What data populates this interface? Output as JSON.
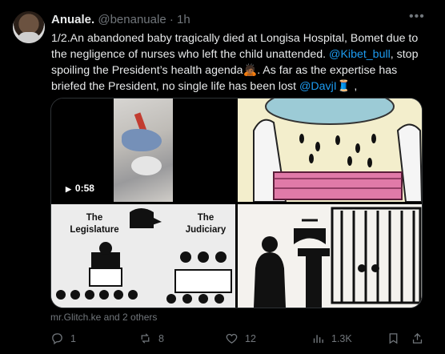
{
  "post": {
    "display_name": "Anuale.",
    "handle": "@benanuale",
    "dot": "·",
    "time": "1h",
    "more_icon": "more-icon",
    "text_part1": "1/2.An abandoned baby tragically died at Longisa Hospital, Bomet due to the negligence of nurses who left the child unattended. ",
    "mention1": "@Kibet_bull",
    "text_part2": ", stop spoiling the President’s health agenda🙇🏾. As far as the expertise has briefed the President, no single life has been lost ",
    "mention2": "@DavjI🧵",
    "text_part3": " ,"
  },
  "media": {
    "video_duration": "0:58",
    "image3_label_left": "The\nLegislature",
    "image3_label_right": "The\nJudiciary"
  },
  "footer_note": "mr.Glitch.ke and 2 others",
  "actions": {
    "reply_count": "1",
    "repost_count": "8",
    "like_count": "12",
    "views_count": "1.3K"
  },
  "colors": {
    "accent": "#1d9bf0",
    "muted": "#71767b",
    "background": "#000000"
  }
}
